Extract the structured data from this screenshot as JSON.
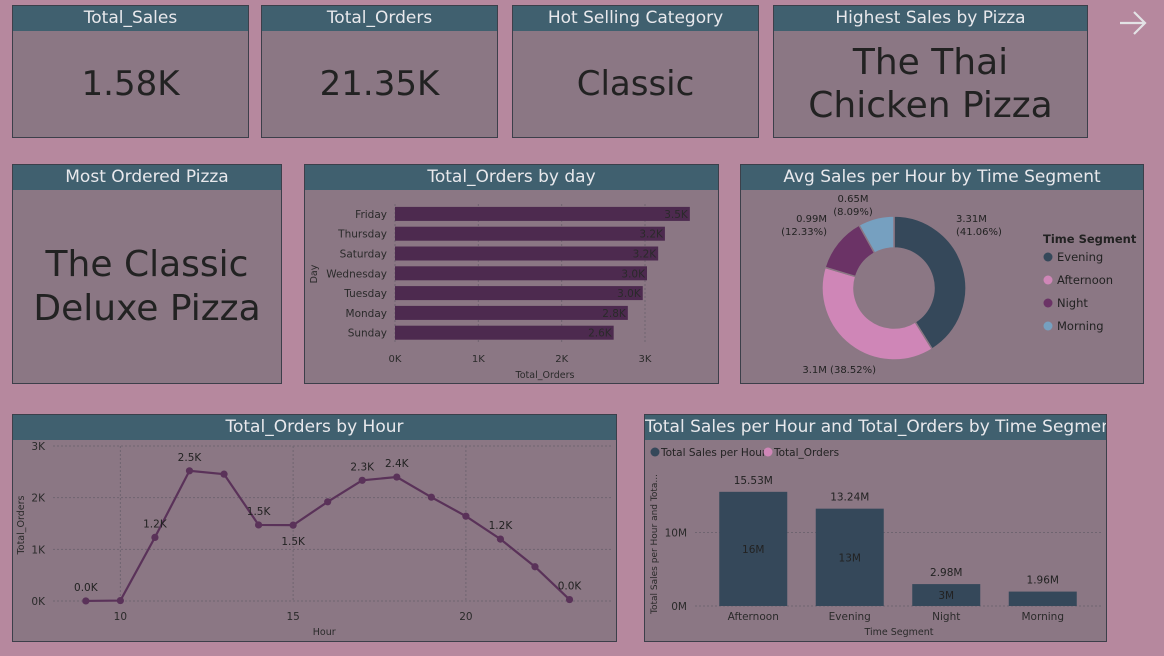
{
  "kpis": {
    "total_sales": {
      "label": "Total_Sales",
      "value": "1.58K"
    },
    "total_orders": {
      "label": "Total_Orders",
      "value": "21.35K"
    },
    "hot_category": {
      "label": "Hot Selling Category",
      "value": "Classic"
    },
    "highest_sales_pizza": {
      "label": "Highest Sales by Pizza",
      "line1": "The Thai",
      "line2": "Chicken Pizza"
    },
    "most_ordered_pizza": {
      "label": "Most Ordered Pizza",
      "line1": "The Classic",
      "line2": "Deluxe Pizza"
    }
  },
  "nav": {
    "icon": "arrow-right-icon"
  },
  "colors": {
    "bg": "#b6889e",
    "card": "#8b7784",
    "header": "#40606f",
    "purple": "#4d2a4f",
    "line": "#5a3259",
    "dark_teal": "#35485a",
    "pink": "#cf86b7",
    "night": "#6b3366",
    "morning": "#76a0c0"
  },
  "chart_data": [
    {
      "type": "bar",
      "orientation": "horizontal",
      "title": "Total_Orders by day",
      "xlabel": "Total_Orders",
      "ylabel": "Day",
      "categories": [
        "Friday",
        "Thursday",
        "Saturday",
        "Wednesday",
        "Tuesday",
        "Monday",
        "Sunday"
      ],
      "values": [
        3538,
        3239,
        3158,
        3024,
        2973,
        2794,
        2624
      ],
      "data_labels": [
        "3.5K",
        "3.2K",
        "3.2K",
        "3.0K",
        "3.0K",
        "2.8K",
        "2.6K"
      ],
      "xticks": [
        "0K",
        "1K",
        "2K",
        "3K"
      ],
      "xlim": [
        0,
        3600
      ],
      "grid": true
    },
    {
      "type": "pie",
      "variant": "donut",
      "title": "Avg Sales per Hour by Time Segment",
      "legend_title": "Time Segment",
      "legend_position": "right",
      "slices": [
        {
          "name": "Evening",
          "value": 3.31,
          "label": "3.31M",
          "pct": "(41.06%)",
          "color": "#35485a"
        },
        {
          "name": "Afternoon",
          "value": 3.1,
          "label": "3.1M (38.52%)",
          "pct": "",
          "color": "#cf86b7"
        },
        {
          "name": "Night",
          "value": 0.99,
          "label": "0.99M",
          "pct": "(12.33%)",
          "color": "#6b3366"
        },
        {
          "name": "Morning",
          "value": 0.65,
          "label": "0.65M",
          "pct": "(8.09%)",
          "color": "#76a0c0"
        }
      ]
    },
    {
      "type": "line",
      "title": "Total_Orders by Hour",
      "xlabel": "Hour",
      "ylabel": "Total_Orders",
      "x": [
        9,
        10,
        11,
        12,
        13,
        14,
        15,
        16,
        17,
        18,
        19,
        20,
        21,
        22,
        23
      ],
      "values": [
        1,
        8,
        1231,
        2520,
        2455,
        1472,
        1468,
        1920,
        2336,
        2399,
        2009,
        1642,
        1198,
        663,
        28
      ],
      "data_labels": {
        "0": "0.0K",
        "2": "1.2K",
        "3": "2.5K",
        "5": "1.5K",
        "6": "1.5K",
        "8": "2.3K",
        "9": "2.4K",
        "12": "1.2K",
        "14": "0.0K"
      },
      "xticks": [
        10,
        15,
        20
      ],
      "yticks": [
        "0K",
        "1K",
        "2K",
        "3K"
      ],
      "xlim": [
        8.05,
        24.2
      ],
      "ylim": [
        0,
        3000
      ],
      "grid": true
    },
    {
      "type": "bar",
      "title": "Total Sales per Hour and Total_Orders by Time Segment",
      "xlabel": "Time Segment",
      "ylabel": "Total Sales per Hour and Tota...",
      "legend_position": "top-left",
      "categories": [
        "Afternoon",
        "Evening",
        "Night",
        "Morning"
      ],
      "series": [
        {
          "name": "Total Sales per Hour",
          "values": [
            15.53,
            13.24,
            2.98,
            1.96
          ],
          "labels": [
            "15.53M",
            "13.24M",
            "2.98M",
            "1.96M"
          ],
          "color": "#35485a"
        },
        {
          "name": "Total_Orders",
          "values": [
            16,
            13,
            3,
            0
          ],
          "labels": [
            "16M",
            "13M",
            "3M",
            ""
          ],
          "color": "#cf86b7"
        }
      ],
      "yticks": [
        "0M",
        "10M"
      ],
      "ylim": [
        0,
        18.5
      ],
      "grid": true
    }
  ]
}
